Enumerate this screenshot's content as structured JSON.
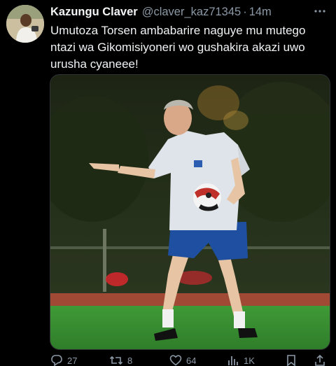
{
  "tweet": {
    "author_name": "Kazungu Claver",
    "author_handle": "@claver_kaz71345",
    "separator": "·",
    "time": "14m",
    "text_lines": [
      "Umutoza Torsen ambabarire naguye mu mutego",
      "ntazi wa Gikomisiyoneri wo gushakira akazi uwo",
      "urusha cyaneee!"
    ]
  },
  "actions": {
    "replies": "27",
    "retweets": "8",
    "likes": "64",
    "views": "1K"
  },
  "icons": {
    "more": "more-dots-icon",
    "reply": "reply-icon",
    "retweet": "retweet-icon",
    "like": "heart-icon",
    "views": "views-chart-icon",
    "bookmark": "bookmark-icon",
    "share": "share-icon"
  },
  "colors": {
    "background": "#000000",
    "text": "#e7e9ea",
    "muted": "#8b98a5"
  }
}
